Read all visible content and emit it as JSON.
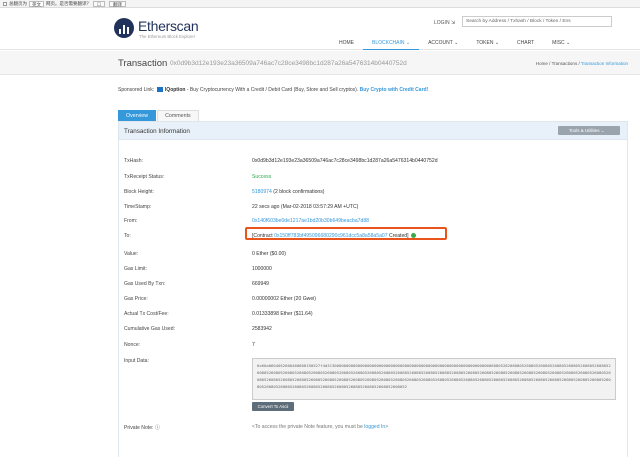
{
  "browser": {
    "always_translate": "总翻页为",
    "language": "英文",
    "question": "网页。是否需要翻译？",
    "action": "翻译"
  },
  "header": {
    "brand": "Etherscan",
    "tagline": "The Ethereum Block Explorer",
    "login": "LOGIN ⇲",
    "search_placeholder": "Search by Address / Txhash / Block / Token / Ens",
    "nav": [
      "HOME",
      "BLOCKCHAIN ⌄",
      "ACCOUNT ⌄",
      "TOKEN ⌄",
      "CHART",
      "MISC ⌄"
    ]
  },
  "title": {
    "label": "Transaction",
    "hash": "0x0d9b3d12e193e23a36509a746ac7c28ce3498bc1d287a26a5476314b0440752d",
    "breadcrumb_home": "Home",
    "breadcrumb_sep1": "/",
    "breadcrumb_mid": "Transactions",
    "breadcrumb_sep2": "/",
    "breadcrumb_current": "Transaction Information"
  },
  "sponsored": {
    "label": "Sponsored Link:",
    "brand": "IQoption",
    "text": " - Buy Cryptocurrency With a Credit / Debit Card (Buy, Store and Sell cryptos). ",
    "link": "Buy Crypto with Credit Card!"
  },
  "tabs": [
    "Overview",
    "Comments"
  ],
  "panel": {
    "title": "Transaction Information",
    "tools": "Tools & Utilities ⌄"
  },
  "fields": {
    "txhash_label": "TxHash:",
    "txhash_value": "0x0d9b3d12e193e23a36509a746ac7c28ce3498bc1d287a26a5476314b0440752d",
    "status_label": "TxReceipt Status:",
    "status_value": "Success",
    "block_label": "Block Height:",
    "block_value": "5180974",
    "block_conf": " (2 block confirmations)",
    "time_label": "TimeStamp:",
    "time_value": "22 secs ago (Mar-02-2018 03:57:29 AM +UTC)",
    "from_label": "From:",
    "from_value": "0x140f603be0de1217ae1bd20b30b649beacba7d88",
    "to_label": "To:",
    "to_prefix": "[Contract ",
    "to_value": "0x150ff783bf495096680290c961dcc5a8a58a5a07",
    "to_suffix": " Created]",
    "value_label": "Value:",
    "value_value": "0 Ether ($0.00)",
    "gaslimit_label": "Gas Limit:",
    "gaslimit_value": "1000000",
    "gasused_label": "Gas Used By Txn:",
    "gasused_value": "669949",
    "gasprice_label": "Gas Price:",
    "gasprice_value": "0.00000002 Ether (20 Gwei)",
    "cost_label": "Actual Tx Cost/Fee:",
    "cost_value": "0.01333898 Ether ($11.64)",
    "cumgas_label": "Cumulative Gas Used:",
    "cumgas_value": "2583942",
    "nonce_label": "Nonce:",
    "nonce_value": "7",
    "input_label": "Input Data:",
    "input_value": "0x60a0604052600460608190527f4d3130000000000000000000000000000000000000000000000000000000000000000000608052820608052608052608052608052608052608052608052608052608052608052608052608052608052608052608052608052608052608052608052608052608052608052608052608052608052608052608052608052608052608052608052608052608052608052608052608052608052608052608052608052608052608052608052608052608052608052608052608052608052608052608052608052608052608052608052608052608052608052608052608052608052608052608052608052608052608052608052608052",
    "convert": "Convert To Ascii",
    "note_label": "Private Note:",
    "note_text": "<To access the private Note feature, you must be ",
    "note_link": "logged In",
    "note_end": ">"
  }
}
